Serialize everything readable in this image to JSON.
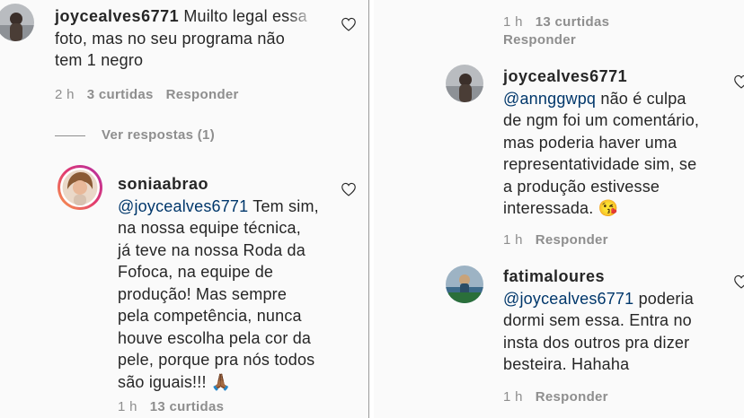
{
  "left": {
    "comment1": {
      "username": "joycealves6771",
      "text_line1": "Muilto legal essa",
      "text_line2": "foto, mas no seu programa não",
      "text_line3": "tem 1 negro",
      "time": "2 h",
      "likes": "3 curtidas",
      "reply": "Responder",
      "view_replies": "Ver respostas (1)"
    },
    "comment2": {
      "username": "soniaabrao",
      "mention": "@joycealves6771",
      "lines": [
        "Tem sim,",
        "na nossa equipe técnica,",
        "já teve na nossa Roda da",
        "Fofoca, na equipe de",
        "produção! Mas sempre",
        "pela competência, nunca",
        "houve escolha pela cor da",
        "pele, porque pra nós todos",
        "são iguais!!! 🙏🏾"
      ],
      "time": "1 h",
      "likes": "13 curtidas"
    }
  },
  "right": {
    "top_meta": {
      "time": "1 h",
      "likes": "13 curtidas",
      "reply": "Responder"
    },
    "comment3": {
      "username": "joycealves6771",
      "mention": "@annggwpq",
      "lines": [
        "não é culpa",
        "de ngm foi um comentário,",
        "mas poderia haver uma",
        "representatividade sim, se",
        "a produção estivesse",
        "interessada. 😘"
      ],
      "time": "1 h",
      "reply": "Responder"
    },
    "comment4": {
      "username": "fatimaloures",
      "mention": "@joycealves6771",
      "lines": [
        "poderia",
        "dormi sem essa. Entra no",
        "insta dos outros pra dizer",
        "besteira. Hahaha"
      ],
      "time": "1 h",
      "reply": "Responder"
    }
  },
  "icons": {
    "heart": "heart-outline-icon",
    "avatar": "user-avatar"
  }
}
